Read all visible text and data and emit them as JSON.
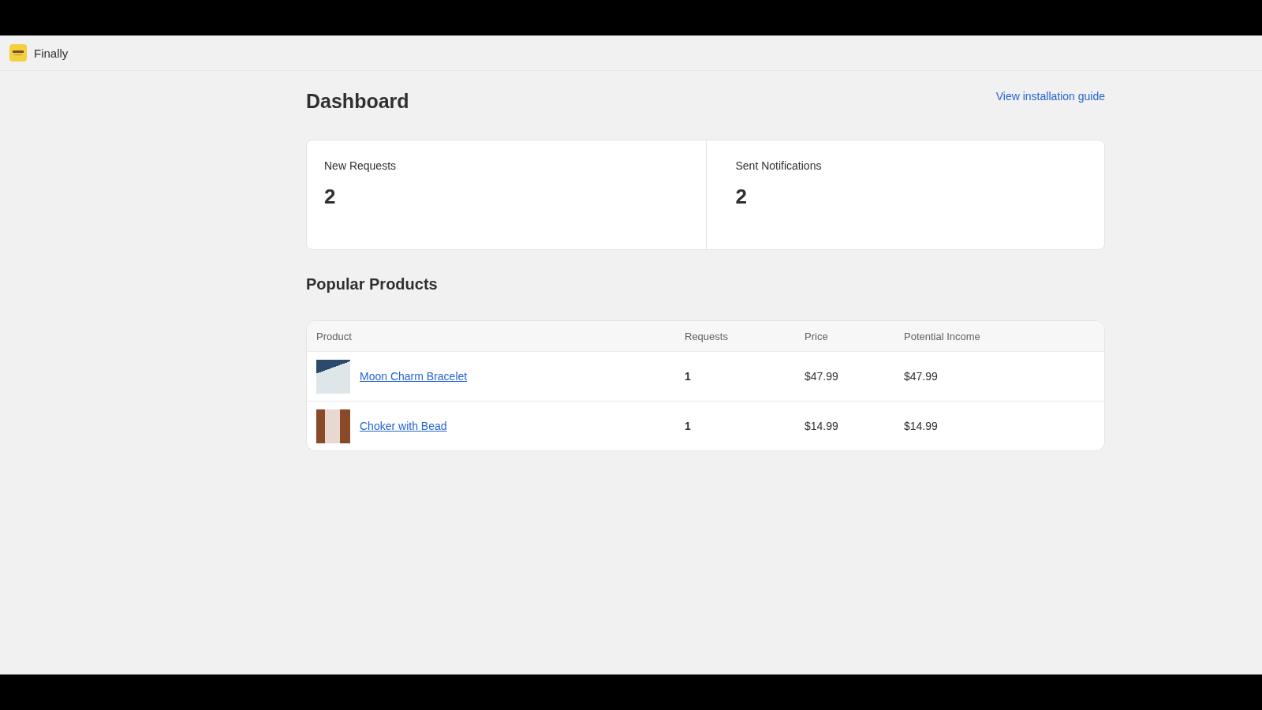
{
  "app_bar": {
    "app_name": "Finally"
  },
  "page": {
    "title": "Dashboard",
    "guide_link": "View installation guide"
  },
  "stats": [
    {
      "label": "New Requests",
      "value": "2"
    },
    {
      "label": "Sent Notifications",
      "value": "2"
    }
  ],
  "popular": {
    "title": "Popular Products",
    "columns": [
      "Product",
      "Requests",
      "Price",
      "Potential Income"
    ],
    "rows": [
      {
        "product": "Moon Charm Bracelet",
        "requests": "1",
        "price": "$47.99",
        "income": "$47.99"
      },
      {
        "product": "Choker with Bead",
        "requests": "1",
        "price": "$14.99",
        "income": "$14.99"
      }
    ]
  }
}
